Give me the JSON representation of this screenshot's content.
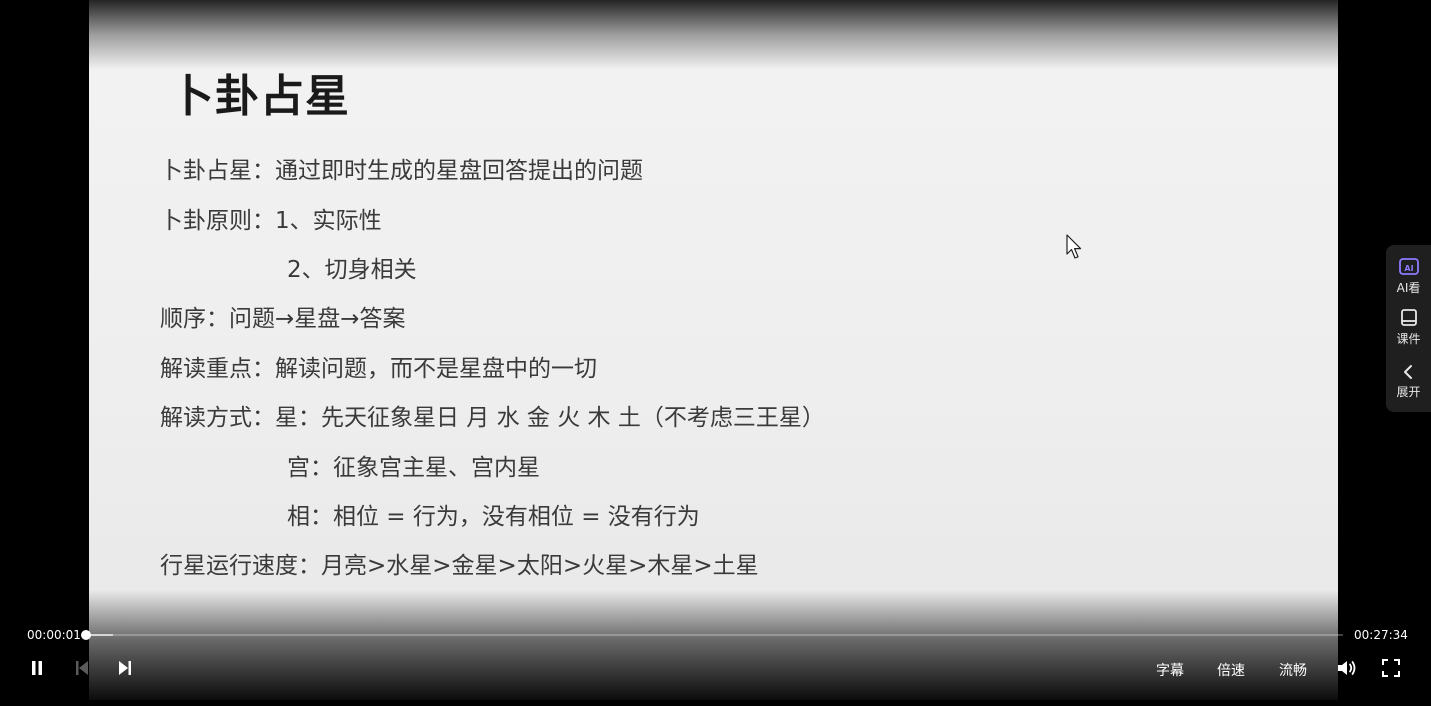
{
  "slide": {
    "title": "卜卦占星",
    "lines": [
      {
        "label": "卜卦占星：",
        "text": "通过即时生成的星盘回答提出的问题"
      },
      {
        "label": "卜卦原则：",
        "text": "1、实际性"
      },
      {
        "label": "",
        "text": "2、切身相关"
      },
      {
        "label": "顺序：",
        "text": "问题→星盘→答案"
      },
      {
        "label": "解读重点：",
        "text": "解读问题，而不是星盘中的一切"
      },
      {
        "label": "解读方式：",
        "text": "星：先天征象星日 月 水 金 火 木 土（不考虑三王星）"
      },
      {
        "label": "",
        "text": "宫：征象宫主星、宫内星"
      },
      {
        "label": "",
        "text": "相：相位 = 行为，没有相位 = 没有行为"
      },
      {
        "label": "行星运行速度：",
        "text": "月亮>水星>金星>太阳>火星>木星>土星"
      }
    ]
  },
  "side_panel": {
    "items": [
      {
        "label": "AI看",
        "icon": "ai-watch-icon"
      },
      {
        "label": "课件",
        "icon": "courseware-icon"
      },
      {
        "label": "展开",
        "icon": "chevron-left-icon"
      }
    ],
    "accent": "#8b7bff"
  },
  "controls": {
    "current_time": "00:00:01",
    "total_time": "00:27:34",
    "progress_fraction": 0.0006,
    "subtitle_label": "字幕",
    "speed_label": "倍速",
    "quality_label": "流畅",
    "icons": {
      "play_pause": "pause-icon",
      "prev": "skip-previous-icon",
      "next": "skip-next-icon",
      "volume": "volume-icon",
      "fullscreen": "fullscreen-icon"
    }
  }
}
